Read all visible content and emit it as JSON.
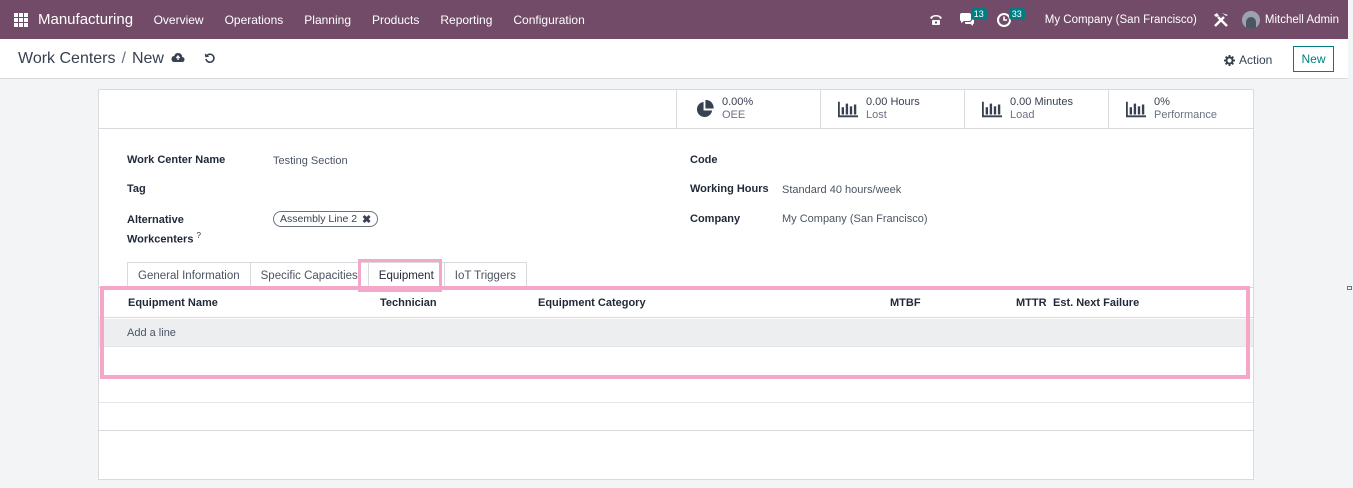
{
  "navbar": {
    "app_name": "Manufacturing",
    "menu": [
      "Overview",
      "Operations",
      "Planning",
      "Products",
      "Reporting",
      "Configuration"
    ],
    "messages_count": "13",
    "activities_count": "33",
    "company": "My Company (San Francisco)",
    "user": "Mitchell Admin"
  },
  "control": {
    "breadcrumb_parent": "Work Centers",
    "breadcrumb_sep": "/",
    "breadcrumb_current": "New",
    "action_label": "Action",
    "new_label": "New"
  },
  "stats": [
    {
      "value": "0.00%",
      "label": "OEE",
      "icon": "pie-chart-icon"
    },
    {
      "value": "0.00 Hours",
      "label": "Lost",
      "icon": "bar-chart-icon"
    },
    {
      "value": "0.00 Minutes",
      "label": "Load",
      "icon": "bar-chart-icon"
    },
    {
      "value": "0%",
      "label": "Performance",
      "icon": "bar-chart-icon"
    }
  ],
  "form": {
    "work_center_name_label": "Work Center Name",
    "work_center_name_value": "Testing Section",
    "tag_label": "Tag",
    "alt_label_line1": "Alternative",
    "alt_label_line2": "Workcenters",
    "alt_help": "?",
    "alt_tag": "Assembly Line 2",
    "code_label": "Code",
    "working_hours_label": "Working Hours",
    "working_hours_value": "Standard 40 hours/week",
    "company_label": "Company",
    "company_value": "My Company (San Francisco)"
  },
  "tabs": [
    "General Information",
    "Specific Capacities",
    "Equipment",
    "IoT Triggers"
  ],
  "active_tab": "Equipment",
  "table": {
    "columns": [
      "Equipment Name",
      "Technician",
      "Equipment Category",
      "MTBF",
      "MTTR",
      "Est. Next Failure"
    ],
    "add_line": "Add a line"
  },
  "colors": {
    "brand": "#714b67",
    "accent": "#017e84",
    "highlight": "#f4a7c8"
  }
}
